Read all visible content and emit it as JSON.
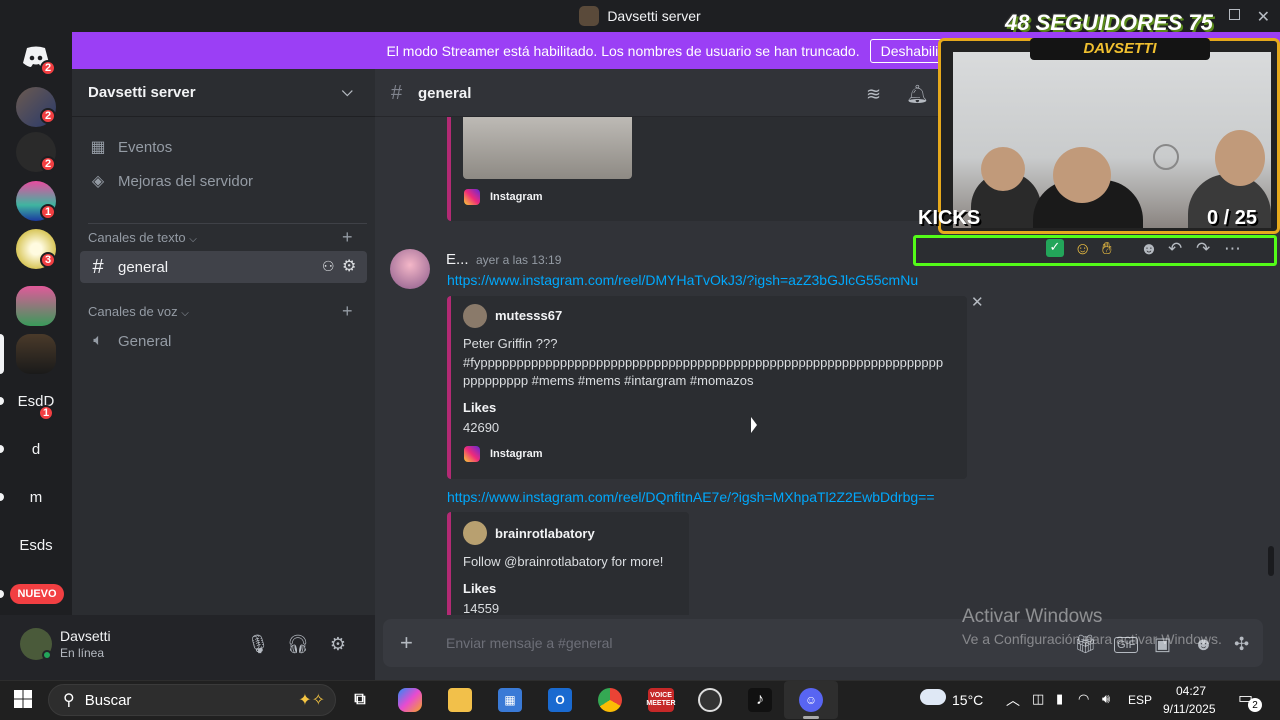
{
  "window": {
    "title": "Davsetti server"
  },
  "banner": {
    "text": "El modo Streamer está habilitado. Los nombres de usuario se han truncado.",
    "button": "Deshabilitar"
  },
  "rail": {
    "badges": [
      "2",
      "2",
      "2",
      "1",
      "3",
      "1"
    ],
    "text_servers": [
      "EsdD",
      "d",
      "m",
      "Esds"
    ],
    "new_label": "NUEVO"
  },
  "sidebar": {
    "server_name": "Davsetti server",
    "items": [
      {
        "label": "Eventos",
        "icon": "calendar-icon"
      },
      {
        "label": "Mejoras del servidor",
        "icon": "boost-icon"
      }
    ],
    "text_category": "Canales de texto",
    "text_channels": [
      {
        "label": "general"
      }
    ],
    "voice_category": "Canales de voz",
    "voice_channels": [
      {
        "label": "General"
      }
    ]
  },
  "user": {
    "name": "Davsetti",
    "status": "En línea"
  },
  "channel": {
    "name": "general"
  },
  "messages": [
    {
      "embed_source": "Instagram"
    },
    {
      "author": "E...",
      "time": "ayer a las 13:19",
      "link": "https://www.instagram.com/reel/DMYHaTvOkJ3/?igsh=azZ3bGJlcG55cmNu",
      "embed": {
        "author": "mutesss67",
        "text_line1": "Peter Griffin ???",
        "text_line2": "#fypppppppppppppppppppppppppppppppppppppppppppppppppppppppppppppppp",
        "text_line3": "ppppppppp #mems #mems #intargram #momazos",
        "field_name": "Likes",
        "field_value": "42690",
        "source": "Instagram"
      }
    },
    {
      "link": "https://www.instagram.com/reel/DQnfitnAE7e/?igsh=MXhpaTl2Z2EwbDdrbg==",
      "embed": {
        "author": "brainrotlabatory",
        "text": "Follow @brainrotlabatory for more!",
        "field_name": "Likes",
        "field_value": "14559"
      }
    }
  ],
  "composer": {
    "placeholder": "Enviar mensaje a #general"
  },
  "watermark": {
    "line1": "Activar Windows",
    "line2": "Ve a Configuración para activar Windows."
  },
  "overlay": {
    "followers": "48 SEGUIDORES 75",
    "streamer": "DAVSETTI",
    "kicks_label": "KICKS",
    "kicks_count": "0 / 25"
  },
  "taskbar": {
    "search": "Buscar",
    "weather": "15°C",
    "lang": "ESP",
    "time": "04:27",
    "date": "9/11/2025",
    "notif": "2",
    "voicemeeter": "VOICE MEETER"
  },
  "colors": {
    "accent": "#9b3ff5",
    "link": "#00a8fc",
    "online": "#23a55a",
    "kick_green": "#53fc18"
  }
}
